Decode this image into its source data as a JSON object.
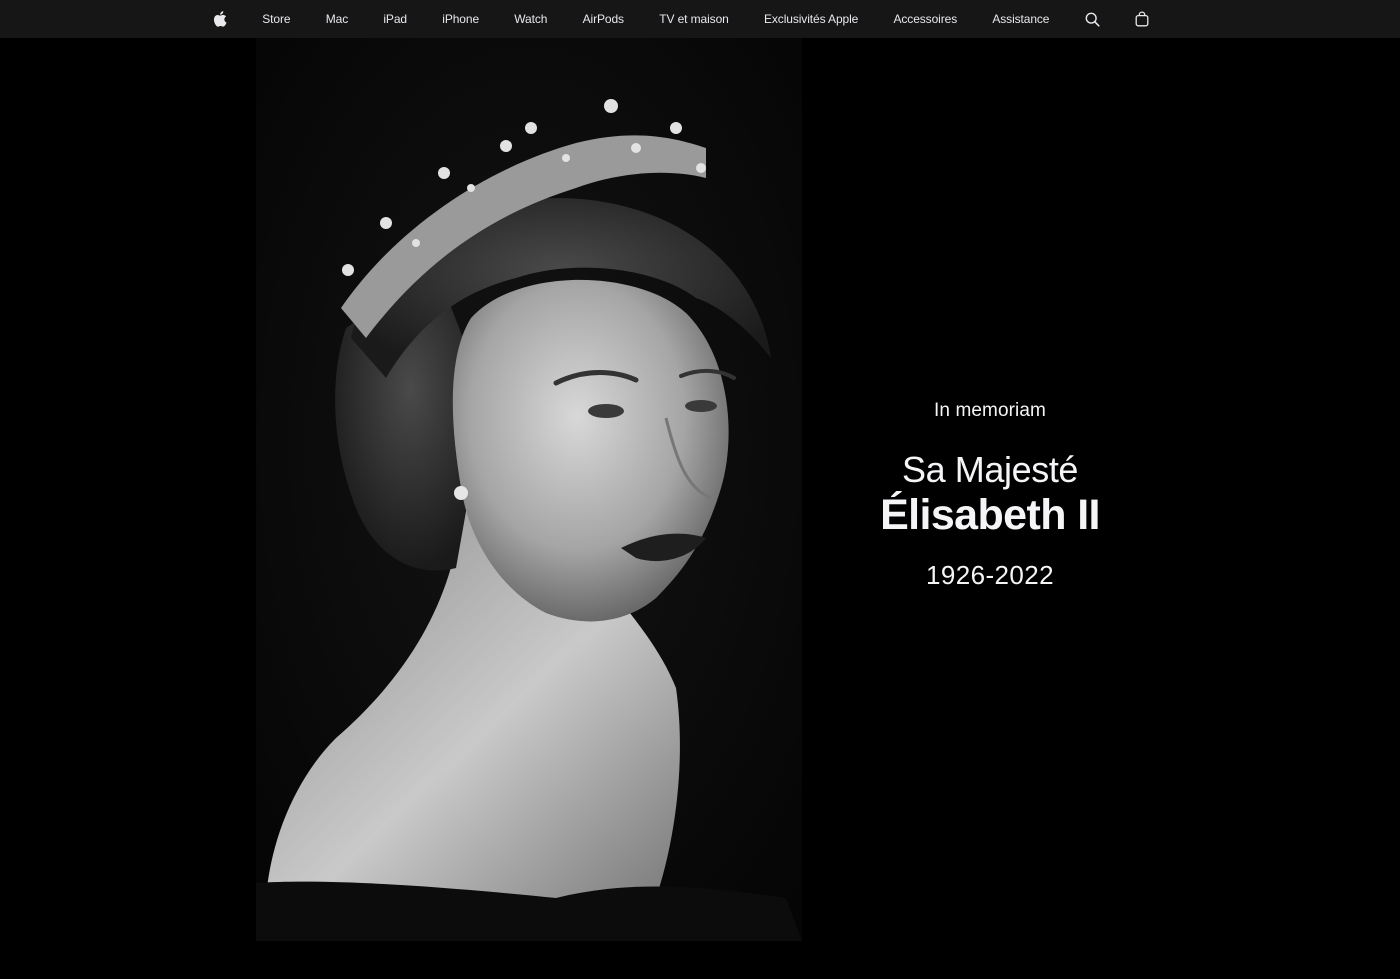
{
  "nav": {
    "logo_icon": "apple-logo-icon",
    "items": [
      "Store",
      "Mac",
      "iPad",
      "iPhone",
      "Watch",
      "AirPods",
      "TV et maison",
      "Exclusivités Apple",
      "Accessoires",
      "Assistance"
    ],
    "search_icon": "search-icon",
    "bag_icon": "shopping-bag-icon"
  },
  "memorial": {
    "eyebrow": "In memoriam",
    "honorific": "Sa Majesté",
    "name": "Élisabeth II",
    "dates": "1926-2022"
  },
  "colors": {
    "nav_background": "#161617",
    "page_background": "#000000",
    "text": "#f5f5f7"
  }
}
